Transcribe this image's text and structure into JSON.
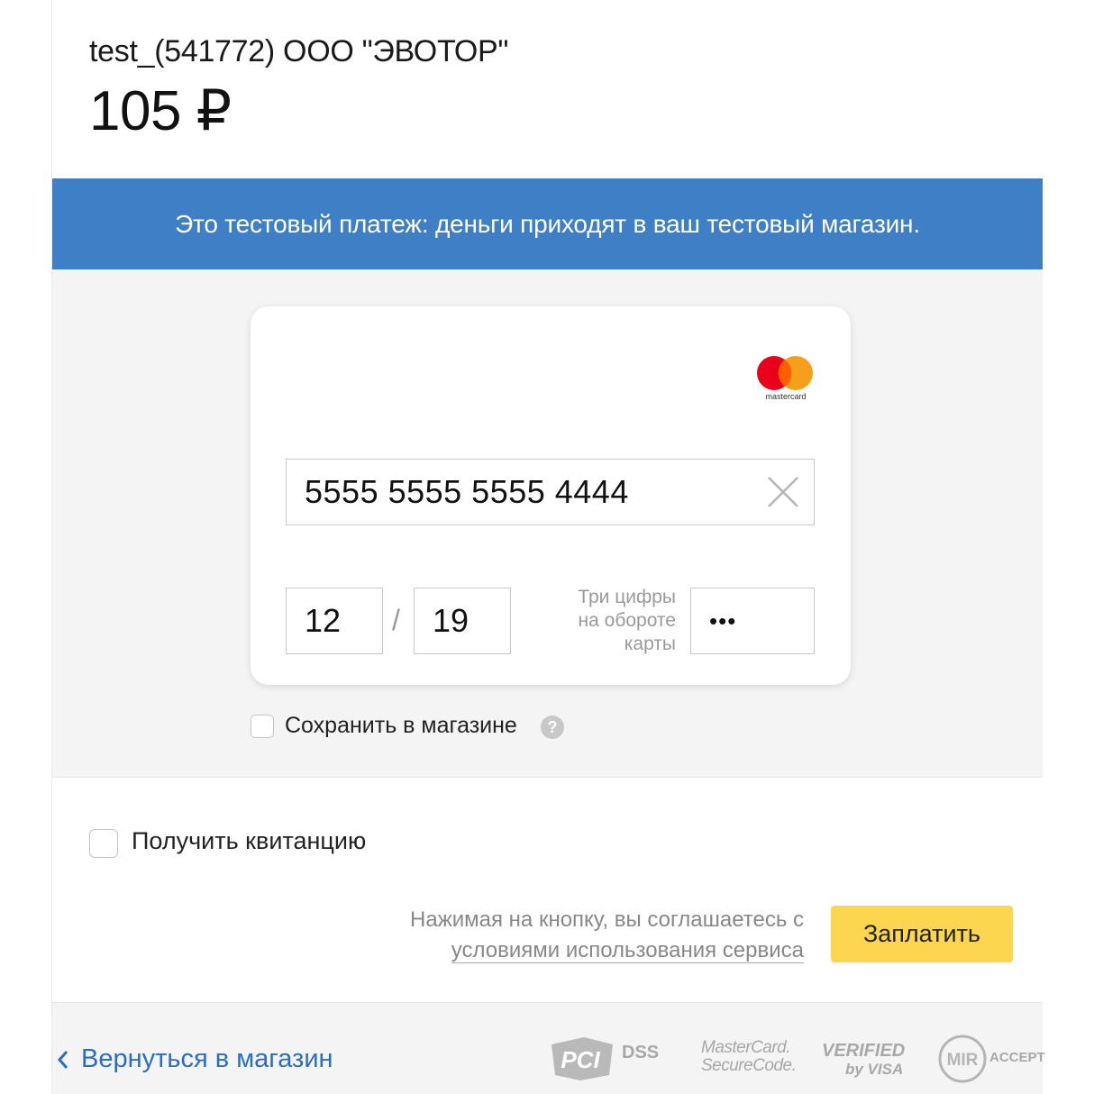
{
  "header": {
    "merchant": "test_(541772) ООО \"ЭВОТОР\"",
    "amount": "105 ₽"
  },
  "banner": {
    "text": "Это тестовый платеж: деньги приходят в ваш тестовый магазин."
  },
  "card_form": {
    "brand_label": "mastercard",
    "card_number": "5555 5555 5555 4444",
    "expiry_month": "12",
    "expiry_separator": "/",
    "expiry_year": "19",
    "cvc_label_line1": "Три цифры",
    "cvc_label_line2": "на обороте",
    "cvc_label_line3": "карты",
    "cvc_value": "•••"
  },
  "save_option": {
    "label": "Сохранить в магазине",
    "checked": false
  },
  "receipt_option": {
    "label": "Получить квитанцию",
    "checked": false
  },
  "terms": {
    "text": "Нажимая на кнопку, вы соглашаетесь с",
    "link": "условиями использования сервиса"
  },
  "pay_button": {
    "label": "Заплатить"
  },
  "footer": {
    "back_link": "Вернуться в магазин",
    "badges": {
      "pci_main": "PCI",
      "pci_dss": "DSS",
      "mastercard_line1": "MasterCard.",
      "mastercard_line2": "SecureCode.",
      "visa_line1": "VERIFIED",
      "visa_line2": "by VISA",
      "mir_main": "MIR",
      "mir_accept": "ACCEPT"
    }
  },
  "colors": {
    "banner": "#3f7fc5",
    "pay_button": "#fcd64e",
    "link": "#2a6ec4",
    "mastercard_red": "#eb001b",
    "mastercard_orange": "#f79e1b"
  }
}
